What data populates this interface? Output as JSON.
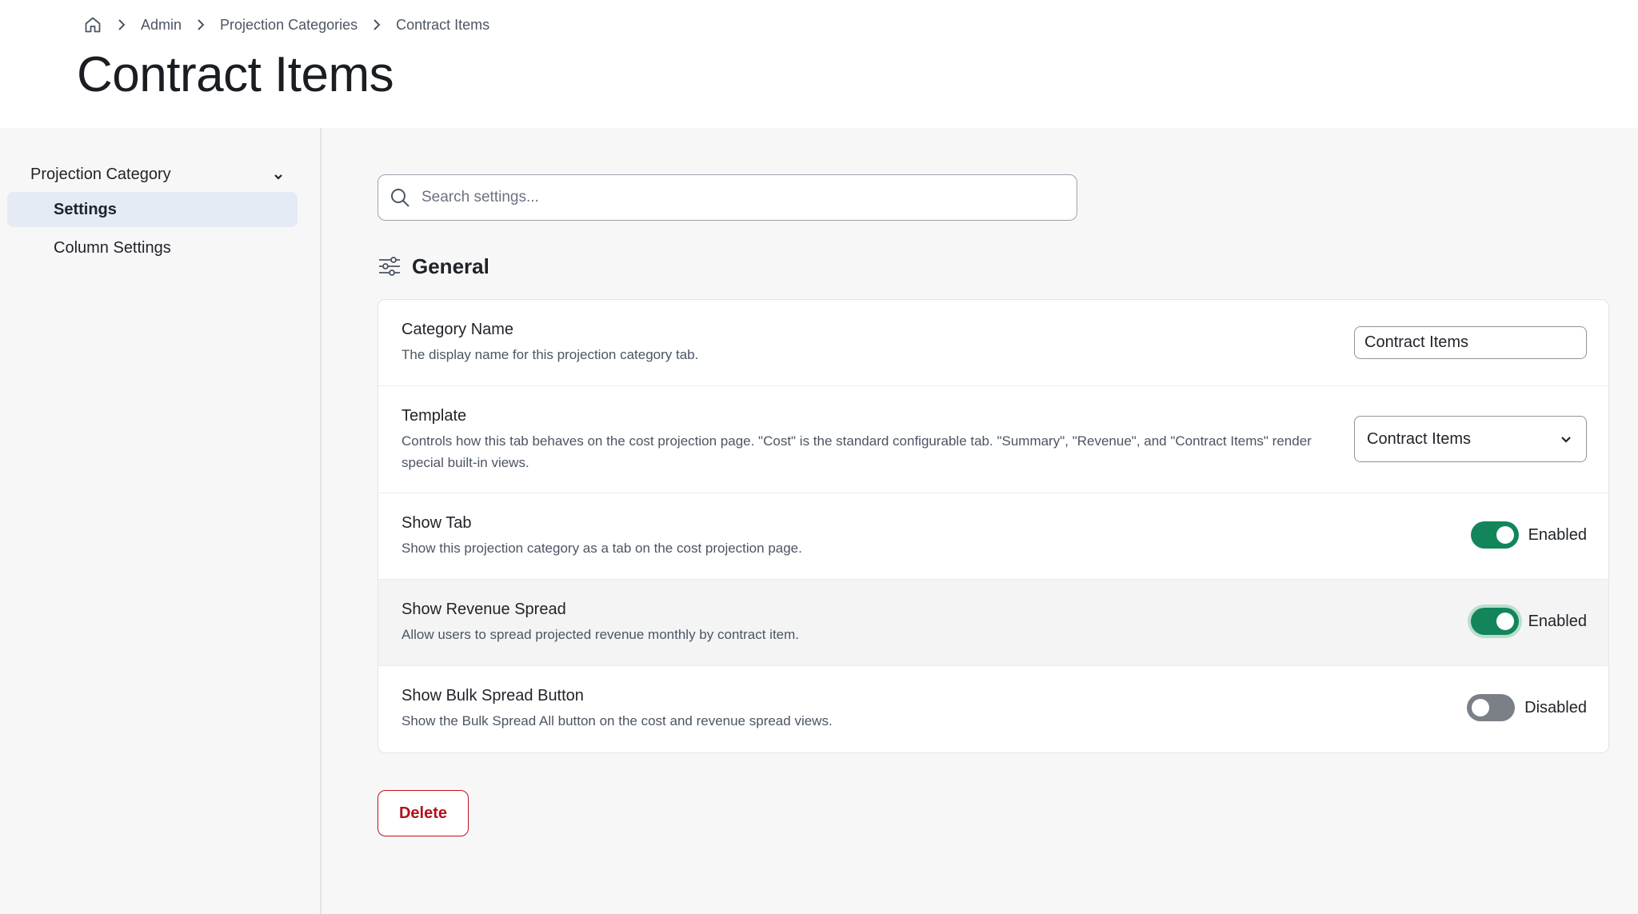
{
  "breadcrumb": {
    "home_icon": "home-icon",
    "items": [
      "Admin",
      "Projection Categories",
      "Contract Items"
    ]
  },
  "page": {
    "title": "Contract Items"
  },
  "sidebar": {
    "group_label": "Projection Category",
    "items": [
      {
        "label": "Settings",
        "active": true
      },
      {
        "label": "Column Settings",
        "active": false
      }
    ]
  },
  "search": {
    "placeholder": "Search settings...",
    "value": ""
  },
  "section": {
    "title": "General",
    "icon": "sliders-icon"
  },
  "settings": [
    {
      "label": "Category Name",
      "description": "The display name for this projection category tab.",
      "control": "text",
      "value": "Contract Items"
    },
    {
      "label": "Template",
      "description": "Controls how this tab behaves on the cost projection page. \"Cost\" is the standard configurable tab. \"Summary\", \"Revenue\", and \"Contract Items\" render special built-in views.",
      "control": "select",
      "value": "Contract Items"
    },
    {
      "label": "Show Tab",
      "description": "Show this projection category as a tab on the cost projection page.",
      "control": "toggle",
      "on": true,
      "state_text": "Enabled"
    },
    {
      "label": "Show Revenue Spread",
      "description": "Allow users to spread projected revenue monthly by contract item.",
      "control": "toggle",
      "on": true,
      "state_text": "Enabled"
    },
    {
      "label": "Show Bulk Spread Button",
      "description": "Show the Bulk Spread All button on the cost and revenue spread views.",
      "control": "toggle",
      "on": false,
      "state_text": "Disabled"
    }
  ],
  "actions": {
    "delete_label": "Delete"
  },
  "colors": {
    "toggle_on": "#12865a",
    "toggle_off": "#7a7f88",
    "danger": "#c1121f",
    "active_nav_bg": "#e4ebf4"
  }
}
